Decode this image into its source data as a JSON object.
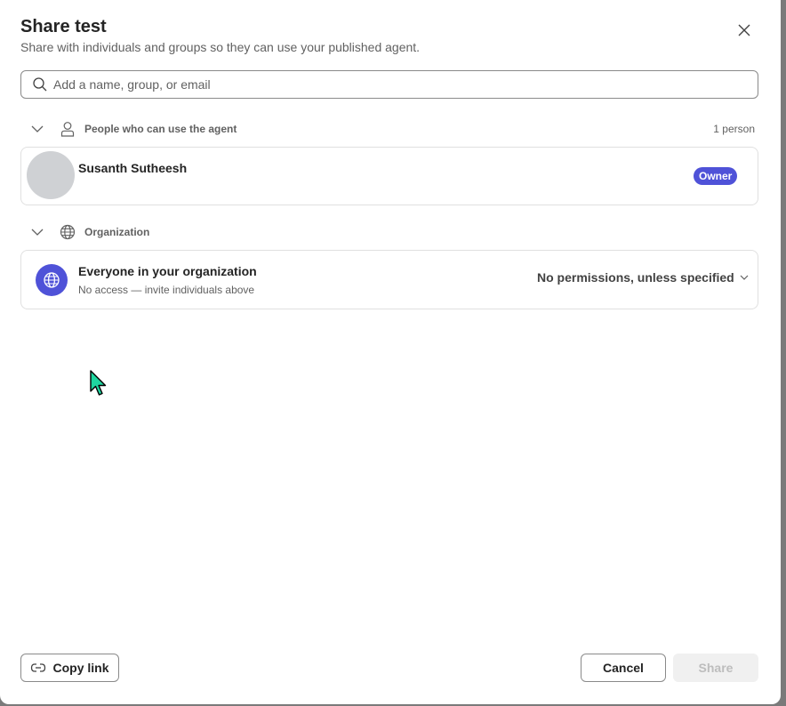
{
  "dialog": {
    "title": "Share test",
    "subtitle": "Share with individuals and groups so they can use your published agent."
  },
  "search": {
    "placeholder": "Add a name, group, or email",
    "icon": "search-icon"
  },
  "people_section": {
    "label": "People who can use the agent",
    "count": "1 person",
    "icon": "person-icon"
  },
  "people": [
    {
      "name": "Susanth Sutheesh",
      "badge": "Owner"
    }
  ],
  "org_section": {
    "label": "Organization",
    "icon": "globe-icon"
  },
  "organization": {
    "name": "Everyone in your organization",
    "description": "No access — invite individuals above",
    "permission": "No permissions, unless specified"
  },
  "footer": {
    "copy_link": "Copy link",
    "cancel": "Cancel",
    "share": "Share"
  },
  "colors": {
    "accent": "#4f52d8",
    "text": "#242424",
    "muted": "#616161",
    "cursor": "#1fd6a0"
  }
}
